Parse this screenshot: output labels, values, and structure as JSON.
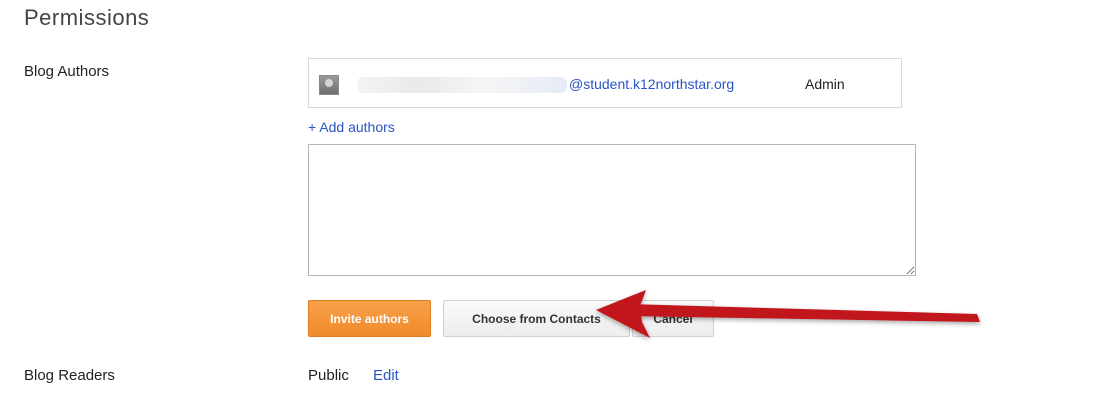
{
  "section_title": "Permissions",
  "blog_authors": {
    "label": "Blog Authors",
    "author": {
      "email": "@student.k12northstar.org",
      "role": "Admin"
    },
    "add_authors_link": "+ Add authors",
    "textarea_value": "",
    "buttons": {
      "invite": "Invite authors",
      "choose_contacts": "Choose from Contacts",
      "cancel": "Cancel"
    }
  },
  "blog_readers": {
    "label": "Blog Readers",
    "value": "Public",
    "edit_link": "Edit"
  },
  "colors": {
    "link": "#2a55c8",
    "primary_button": "#f08b2a",
    "annotation_arrow": "#c0161b"
  },
  "annotation": {
    "icon": "red-arrow-icon"
  }
}
